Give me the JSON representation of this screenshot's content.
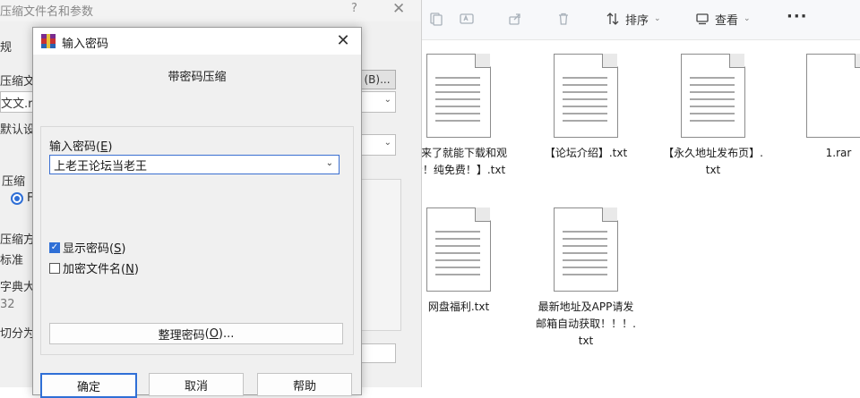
{
  "explorer": {
    "toolbar": {
      "sort_label": "排序",
      "view_label": "查看",
      "more_label": "···"
    },
    "files": [
      {
        "name": "【来了就能下载和观看！纯免费！】.txt",
        "type": "txt"
      },
      {
        "name": "【论坛介绍】.txt",
        "type": "txt"
      },
      {
        "name": "【永久地址发布页】.txt",
        "type": "txt"
      },
      {
        "name": "1.rar",
        "type": "rar"
      },
      {
        "name": "网盘福利.txt",
        "type": "txt"
      },
      {
        "name": "最新地址及APP请发邮箱自动获取！！！.txt",
        "type": "txt"
      }
    ]
  },
  "back_dialog": {
    "title": "压缩文件名和参数",
    "help_q": "?",
    "close": "✕",
    "fragments": [
      "规",
      "压缩文",
      "文文.r",
      "默认设",
      "压缩",
      "压缩方",
      "标准",
      "字典大",
      "32",
      "切分为"
    ],
    "browse_label": "(B)...",
    "radio_text": "F"
  },
  "dialog": {
    "title": "输入密码",
    "close_glyph": "✕",
    "header": "带密码压缩",
    "password_label": "输入密码",
    "password_accel": "E",
    "password_value": "上老王论坛当老王",
    "show_password_label": "显示密码",
    "show_password_accel": "S",
    "show_password_checked": true,
    "encrypt_names_label": "加密文件名",
    "encrypt_names_accel": "N",
    "encrypt_names_checked": false,
    "organize_label": "整理密码",
    "organize_accel": "O",
    "buttons": {
      "ok": "确定",
      "cancel": "取消",
      "help": "帮助"
    }
  }
}
